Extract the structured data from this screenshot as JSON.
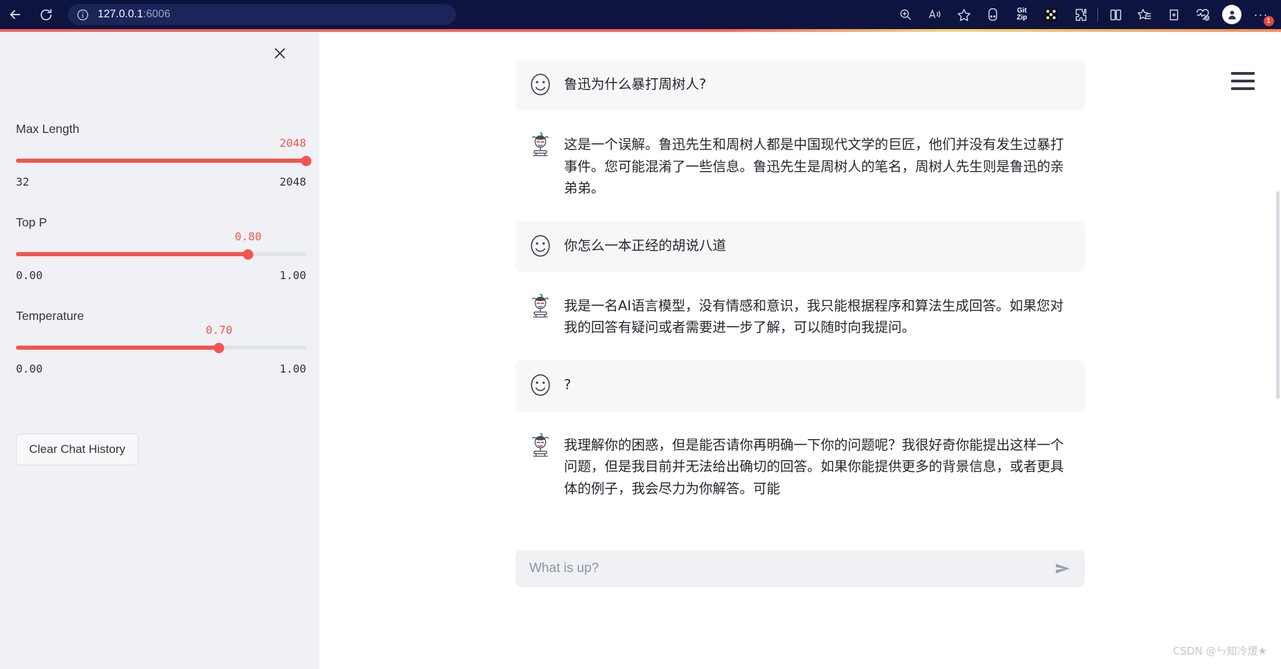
{
  "browser": {
    "back_label": "Back",
    "reload_label": "Refresh",
    "info_icon": "info-circle-icon",
    "url_host": "127.0.0.1",
    "url_port": ":6006",
    "toolbar_icons": [
      {
        "name": "zoom-icon",
        "glyph": "search-plus"
      },
      {
        "name": "read-aloud-icon",
        "glyph": "A"
      },
      {
        "name": "favorite-star-icon",
        "glyph": "star"
      },
      {
        "name": "extension-oo-icon",
        "glyph": "oo"
      },
      {
        "name": "extension-gitzip-icon",
        "glyph": "Git Zip"
      },
      {
        "name": "extension-dark-icon",
        "glyph": "grid"
      },
      {
        "name": "extension-puzzle-icon",
        "glyph": "puzzle"
      },
      {
        "name": "split-screen-icon",
        "glyph": "split"
      },
      {
        "name": "collections-icon",
        "glyph": "favorites-list"
      },
      {
        "name": "add-device-icon",
        "glyph": "device-plus"
      },
      {
        "name": "browser-essentials-icon",
        "glyph": "heart-pulse"
      },
      {
        "name": "profile-avatar-icon",
        "glyph": "person"
      },
      {
        "name": "more-options-icon",
        "glyph": "ellipsis"
      }
    ],
    "more_badge": "1"
  },
  "sidebar": {
    "close_label": "Close",
    "controls": [
      {
        "id": "max-length",
        "label": "Max Length",
        "value": "2048",
        "min": "32",
        "max": "2048",
        "percent": 100
      },
      {
        "id": "top-p",
        "label": "Top P",
        "value": "0.80",
        "min": "0.00",
        "max": "1.00",
        "percent": 80
      },
      {
        "id": "temperature",
        "label": "Temperature",
        "value": "0.70",
        "min": "0.00",
        "max": "1.00",
        "percent": 70
      }
    ],
    "clear_button": "Clear Chat History"
  },
  "chat": {
    "messages": [
      {
        "role": "user",
        "avatar": "smiley-face-icon",
        "text": "鲁迅为什么暴打周树人?"
      },
      {
        "role": "bot",
        "avatar": "chatglm-robot-icon",
        "text": "这是一个误解。鲁迅先生和周树人都是中国现代文学的巨匠，他们并没有发生过暴打事件。您可能混淆了一些信息。鲁迅先生是周树人的笔名，周树人先生则是鲁迅的亲弟弟。"
      },
      {
        "role": "user",
        "avatar": "smiley-face-icon",
        "text": "你怎么一本正经的胡说八道"
      },
      {
        "role": "bot",
        "avatar": "chatglm-robot-icon",
        "text": "我是一名AI语言模型，没有情感和意识，我只能根据程序和算法生成回答。如果您对我的回答有疑问或者需要进一步了解，可以随时向我提问。"
      },
      {
        "role": "user",
        "avatar": "smiley-face-icon",
        "text": "?"
      },
      {
        "role": "bot",
        "avatar": "chatglm-robot-icon",
        "text": "我理解你的困惑，但是能否请你再明确一下你的问题呢？我很好奇你能提出这样一个问题，但是我目前并无法给出确切的回答。如果你能提供更多的背景信息，或者更具体的例子，我会尽力为你解答。可能"
      }
    ]
  },
  "composer": {
    "placeholder": "What is up?",
    "value": "",
    "send_label": "Send"
  },
  "menu": {
    "hamburger_label": "Main menu"
  },
  "watermark": "CSDN @ㄣ知冷煖★",
  "colors": {
    "accent_red": "#f4554f",
    "browser_bg": "#0d1440",
    "sidebar_bg": "#eff1f5",
    "user_bubble": "#f6f7f9"
  }
}
